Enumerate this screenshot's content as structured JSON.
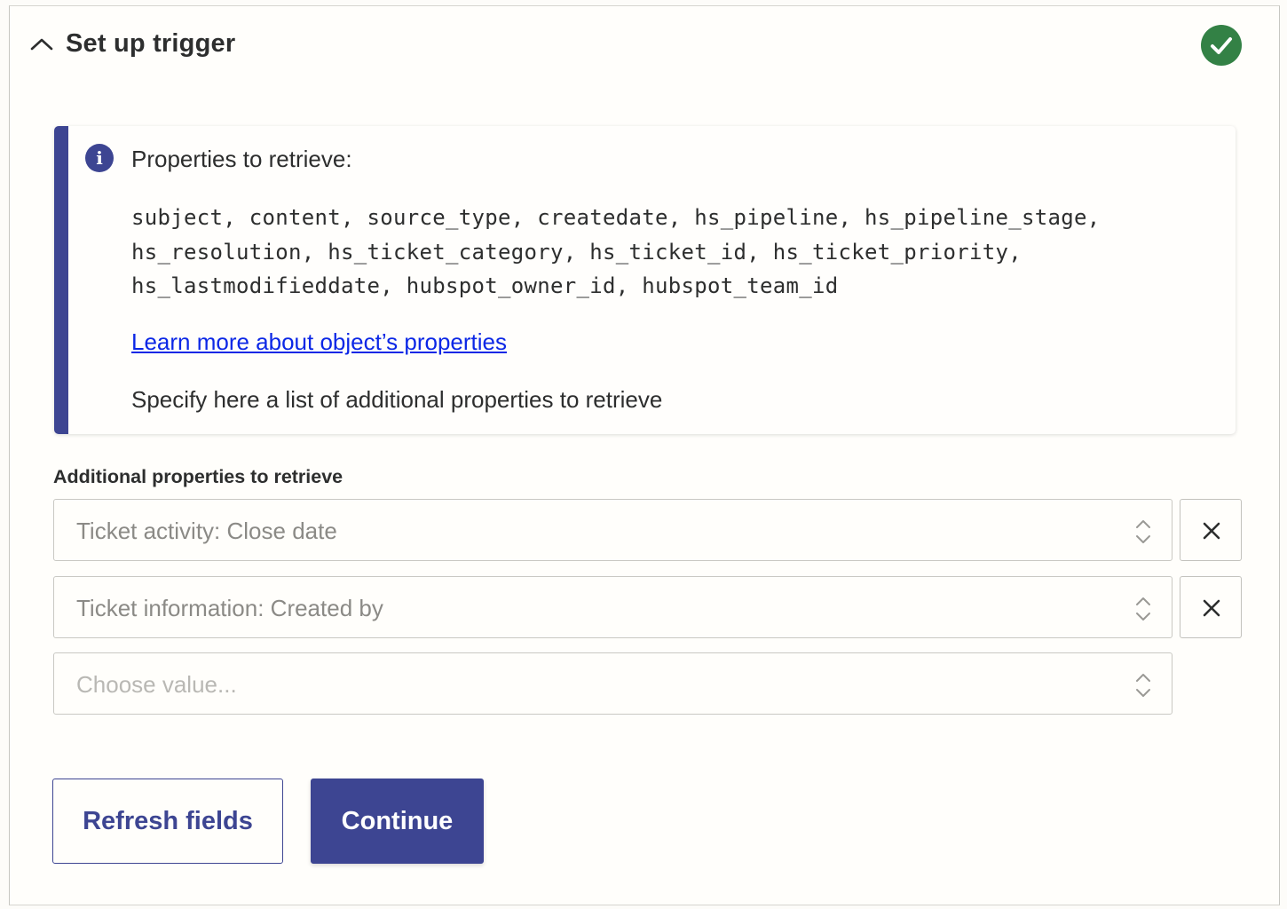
{
  "section": {
    "title": "Set up trigger",
    "chevron_icon": "chevron-up-icon",
    "status_icon": "check-circle-icon",
    "status_color": "#338145"
  },
  "info_box": {
    "icon": "info-icon",
    "icon_glyph": "i",
    "heading": "Properties to retrieve:",
    "code_lines": [
      "subject, content, source_type, createdate, hs_pipeline, hs_pipeline_stage,",
      "hs_resolution, hs_ticket_category, hs_ticket_id, hs_ticket_priority,",
      "hs_lastmodifieddate, hubspot_owner_id, hubspot_team_id"
    ],
    "link_text": "Learn more about object’s properties",
    "note": "Specify here a list of additional properties to retrieve",
    "accent_color": "#3d4592"
  },
  "fields": {
    "label": "Additional properties to retrieve",
    "items": [
      {
        "value": "Ticket activity: Close date"
      },
      {
        "value": "Ticket information: Created by"
      }
    ],
    "empty_placeholder": "Choose value..."
  },
  "buttons": {
    "refresh": "Refresh fields",
    "continue": "Continue"
  },
  "colors": {
    "primary": "#3d4592",
    "link": "#0b27e6",
    "success": "#338145"
  }
}
